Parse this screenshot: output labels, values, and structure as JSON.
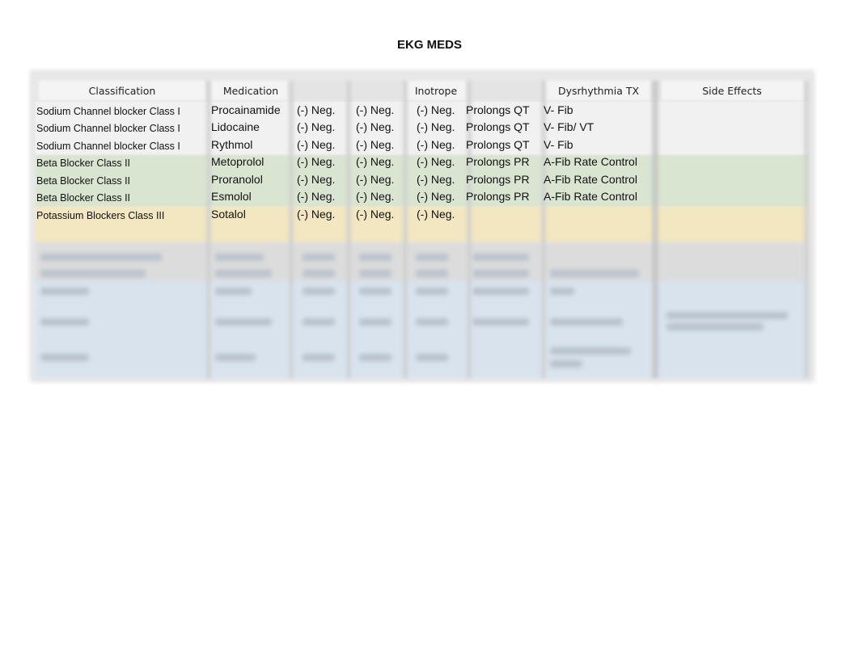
{
  "document": {
    "title": "EKG MEDS"
  },
  "table": {
    "headers": {
      "classification": "Classification",
      "medication": "Medication",
      "inotrope": "Inotrope",
      "dysrhythmia_tx": "Dysrhythmia TX",
      "side_effects": "Side Effects"
    },
    "rows": [
      {
        "classification": "Sodium Channel blocker Class I",
        "medication": "Procainamide",
        "col3": "(-) Neg.",
        "col4": "(-) Neg.",
        "inotrope": "(-) Neg.",
        "ekg": "Prolongs QT",
        "dysrhythmia_tx": "V- Fib",
        "side_effects": "",
        "group": "sodium"
      },
      {
        "classification": "Sodium Channel blocker Class I",
        "medication": "Lidocaine",
        "col3": "(-) Neg.",
        "col4": "(-) Neg.",
        "inotrope": "(-) Neg.",
        "ekg": "Prolongs QT",
        "dysrhythmia_tx": "V- Fib/ VT",
        "side_effects": "",
        "group": "sodium"
      },
      {
        "classification": "Sodium Channel blocker Class I",
        "medication": "Rythmol",
        "col3": "(-) Neg.",
        "col4": "(-) Neg.",
        "inotrope": "(-) Neg.",
        "ekg": "Prolongs QT",
        "dysrhythmia_tx": "V- Fib",
        "side_effects": "",
        "group": "sodium"
      },
      {
        "classification": "Beta Blocker Class II",
        "medication": "Metoprolol",
        "col3": "(-) Neg.",
        "col4": "(-) Neg.",
        "inotrope": "(-) Neg.",
        "ekg": "Prolongs PR",
        "dysrhythmia_tx": "A-Fib Rate Control",
        "side_effects": "",
        "group": "beta"
      },
      {
        "classification": "Beta Blocker Class II",
        "medication": "Proranolol",
        "col3": "(-) Neg.",
        "col4": "(-) Neg.",
        "inotrope": "(-) Neg.",
        "ekg": "Prolongs PR",
        "dysrhythmia_tx": "A-Fib Rate Control",
        "side_effects": "",
        "group": "beta"
      },
      {
        "classification": "Beta Blocker Class II",
        "medication": "Esmolol",
        "col3": "(-) Neg.",
        "col4": "(-) Neg.",
        "inotrope": "(-) Neg.",
        "ekg": "Prolongs PR",
        "dysrhythmia_tx": "A-Fib Rate Control",
        "side_effects": "",
        "group": "beta"
      },
      {
        "classification": "Potassium Blockers Class III",
        "medication": "Sotalol",
        "col3": "(-) Neg.",
        "col4": "(-) Neg.",
        "inotrope": "(-) Neg.",
        "ekg": "",
        "dysrhythmia_tx": "",
        "side_effects": "",
        "group": "potassium"
      }
    ],
    "group_colors": {
      "header": "#f4f4f4",
      "sodium": "#f1f1f1",
      "beta": "#d9e5d1",
      "potassium": "#f2e7c0",
      "gray_blurred": "#dcdcdc",
      "blue_blurred": "#d8e3ee"
    },
    "blurred_preview_note": ""
  }
}
